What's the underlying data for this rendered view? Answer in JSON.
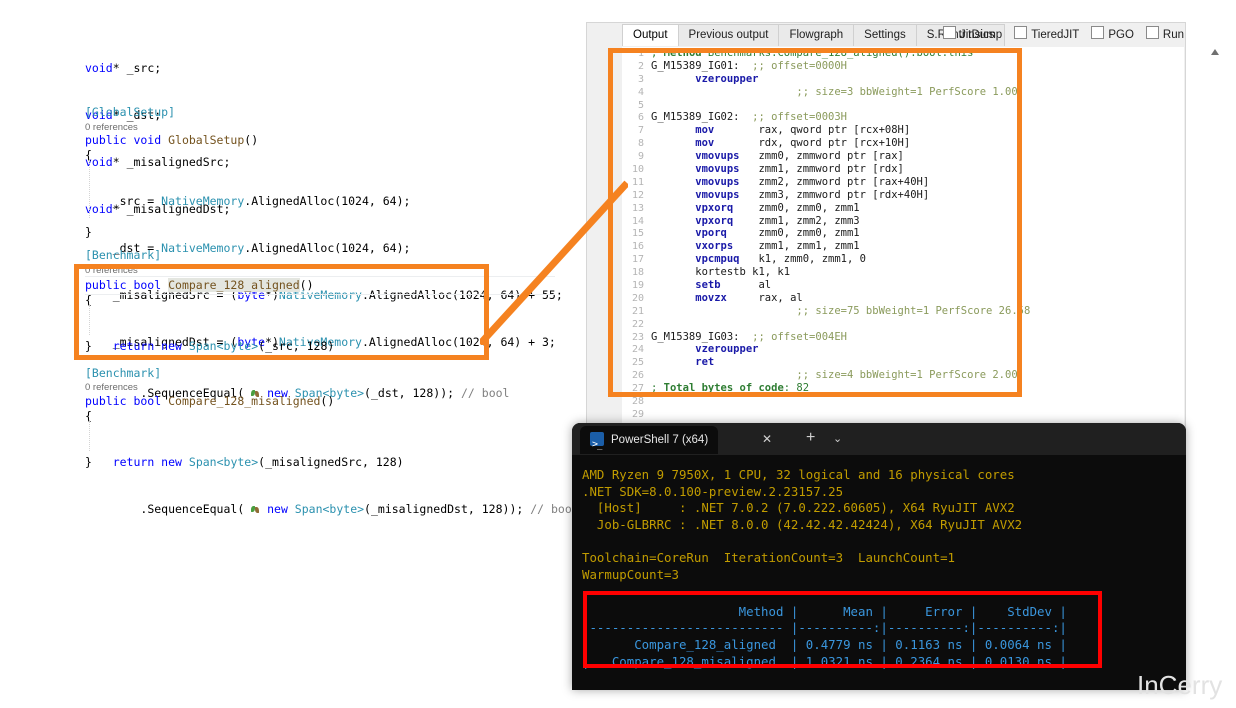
{
  "editor": {
    "fields": [
      "void* _src;",
      "void* _dst;",
      "void* _misalignedSrc;",
      "void* _misalignedDst;"
    ],
    "global_setup": {
      "attribute": "[GlobalSetup]",
      "codelens": "0 references",
      "signature_prefix": "public void ",
      "signature_name": "GlobalSetup",
      "signature_suffix": "()",
      "open_brace": "{",
      "body": [
        "_src = NativeMemory.AlignedAlloc(1024, 64);",
        "_dst = NativeMemory.AlignedAlloc(1024, 64);",
        "_misalignedSrc = (byte*)NativeMemory.AlignedAlloc(1024, 64) + 55;",
        "_misalignedDst = (byte*)NativeMemory.AlignedAlloc(1024, 64) + 3;"
      ],
      "close_brace": "}"
    },
    "benchmark_aligned": {
      "attribute": "[Benchmark]",
      "codelens": "0 references",
      "signature_prefix": "public bool ",
      "signature_name": "Compare_128_aligned",
      "signature_suffix": "()",
      "open_brace": "{",
      "line1_return": "return new ",
      "line1_type": "Span",
      "line1_generic": "<byte>",
      "line1_args": "(_src, 128)",
      "line2_method": ".SequenceEqual( ",
      "line2_new": "new ",
      "line2_type": "Span",
      "line2_generic": "<byte>",
      "line2_args": "(_dst, 128));",
      "line2_comment": "// bool",
      "close_brace": "}"
    },
    "benchmark_misaligned": {
      "attribute": "[Benchmark]",
      "codelens": "0 references",
      "signature_prefix": "public bool ",
      "signature_name": "Compare_128_misaligned",
      "signature_suffix": "()",
      "open_brace": "{",
      "line1_return": "return new ",
      "line1_type": "Span",
      "line1_generic": "<byte>",
      "line1_args": "(_misalignedSrc, 128)",
      "line2_method": ".SequenceEqual( ",
      "line2_new": "new ",
      "line2_type": "Span",
      "line2_generic": "<byte>",
      "line2_args": "(_misalignedDst, 128));",
      "line2_comment": "// bool",
      "close_brace": "}"
    }
  },
  "disasm_panel": {
    "tabs": [
      {
        "label": "Output",
        "active": true
      },
      {
        "label": "Previous output",
        "active": false
      },
      {
        "label": "Flowgraph",
        "active": false
      },
      {
        "label": "Settings",
        "active": false
      },
      {
        "label": "S.R.Intrinsics",
        "active": false
      }
    ],
    "checkboxes": [
      {
        "label": "JitDump",
        "checked": false
      },
      {
        "label": "TieredJIT",
        "checked": false
      },
      {
        "label": "PGO",
        "checked": false
      },
      {
        "label": "Run",
        "checked": false
      }
    ],
    "asm_lines": [
      {
        "n": "1",
        "segs": [
          {
            "t": "; ",
            "c": "a-green"
          },
          {
            "t": "Method",
            "c": "a-cmt"
          },
          {
            "t": " Benchmarks:Compare_128_aligned():bool:this",
            "c": "a-green"
          }
        ]
      },
      {
        "n": "2",
        "segs": [
          {
            "t": "G_M15389_IG01:",
            "c": "a-lbl"
          },
          {
            "t": "  ;; offset=0000H",
            "c": "a-cmt2"
          }
        ]
      },
      {
        "n": "3",
        "segs": [
          {
            "t": "       vzeroupper",
            "c": "a-ins"
          }
        ]
      },
      {
        "n": "4",
        "segs": [
          {
            "t": "                       ;; size=3 bbWeight=1 PerfScore 1.00",
            "c": "a-cmt2"
          }
        ]
      },
      {
        "n": "5",
        "segs": []
      },
      {
        "n": "6",
        "segs": [
          {
            "t": "G_M15389_IG02:",
            "c": "a-lbl"
          },
          {
            "t": "  ;; offset=0003H",
            "c": "a-cmt2"
          }
        ]
      },
      {
        "n": "7",
        "segs": [
          {
            "t": "       mov",
            "c": "a-ins"
          },
          {
            "t": "       rax, qword ptr [rcx+08H]",
            "c": "a-op"
          }
        ]
      },
      {
        "n": "8",
        "segs": [
          {
            "t": "       mov",
            "c": "a-ins"
          },
          {
            "t": "       rdx, qword ptr [rcx+10H]",
            "c": "a-op"
          }
        ]
      },
      {
        "n": "9",
        "segs": [
          {
            "t": "       vmovups",
            "c": "a-ins"
          },
          {
            "t": "   zmm0, zmmword ptr [rax]",
            "c": "a-op"
          }
        ]
      },
      {
        "n": "10",
        "segs": [
          {
            "t": "       vmovups",
            "c": "a-ins"
          },
          {
            "t": "   zmm1, zmmword ptr [rdx]",
            "c": "a-op"
          }
        ]
      },
      {
        "n": "11",
        "segs": [
          {
            "t": "       vmovups",
            "c": "a-ins"
          },
          {
            "t": "   zmm2, zmmword ptr [rax+40H]",
            "c": "a-op"
          }
        ]
      },
      {
        "n": "12",
        "segs": [
          {
            "t": "       vmovups",
            "c": "a-ins"
          },
          {
            "t": "   zmm3, zmmword ptr [rdx+40H]",
            "c": "a-op"
          }
        ]
      },
      {
        "n": "13",
        "segs": [
          {
            "t": "       vpxorq",
            "c": "a-ins"
          },
          {
            "t": "    zmm0, zmm0, zmm1",
            "c": "a-op"
          }
        ]
      },
      {
        "n": "14",
        "segs": [
          {
            "t": "       vpxorq",
            "c": "a-ins"
          },
          {
            "t": "    zmm1, zmm2, zmm3",
            "c": "a-op"
          }
        ]
      },
      {
        "n": "15",
        "segs": [
          {
            "t": "       vporq",
            "c": "a-ins"
          },
          {
            "t": "     zmm0, zmm0, zmm1",
            "c": "a-op"
          }
        ]
      },
      {
        "n": "16",
        "segs": [
          {
            "t": "       vxorps",
            "c": "a-ins"
          },
          {
            "t": "    zmm1, zmm1, zmm1",
            "c": "a-op"
          }
        ]
      },
      {
        "n": "17",
        "segs": [
          {
            "t": "       vpcmpuq",
            "c": "a-ins"
          },
          {
            "t": "   k1, zmm0, zmm1, 0",
            "c": "a-op"
          }
        ]
      },
      {
        "n": "18",
        "segs": [
          {
            "t": "       kortestb k1, k1",
            "c": "a-op"
          }
        ]
      },
      {
        "n": "19",
        "segs": [
          {
            "t": "       setb",
            "c": "a-ins"
          },
          {
            "t": "      al",
            "c": "a-op"
          }
        ]
      },
      {
        "n": "20",
        "segs": [
          {
            "t": "       movzx",
            "c": "a-ins"
          },
          {
            "t": "     rax, al",
            "c": "a-op"
          }
        ]
      },
      {
        "n": "21",
        "segs": [
          {
            "t": "                       ;; size=75 bbWeight=1 PerfScore 26.58",
            "c": "a-cmt2"
          }
        ]
      },
      {
        "n": "22",
        "segs": []
      },
      {
        "n": "23",
        "segs": [
          {
            "t": "G_M15389_IG03:",
            "c": "a-lbl"
          },
          {
            "t": "  ;; offset=004EH",
            "c": "a-cmt2"
          }
        ]
      },
      {
        "n": "24",
        "segs": [
          {
            "t": "       vzeroupper",
            "c": "a-ins"
          }
        ]
      },
      {
        "n": "25",
        "segs": [
          {
            "t": "       ret",
            "c": "a-ins"
          }
        ]
      },
      {
        "n": "26",
        "segs": [
          {
            "t": "                       ;; size=4 bbWeight=1 PerfScore 2.00",
            "c": "a-cmt2"
          }
        ]
      },
      {
        "n": "27",
        "segs": [
          {
            "t": "; ",
            "c": "a-green"
          },
          {
            "t": "Total bytes of code",
            "c": "a-cmt"
          },
          {
            "t": ": 82",
            "c": "a-green"
          }
        ]
      },
      {
        "n": "28",
        "segs": []
      },
      {
        "n": "29",
        "segs": []
      }
    ]
  },
  "terminal": {
    "tab_title": "PowerShell 7 (x64)",
    "close_label": "✕",
    "new_tab_label": "+",
    "menu_label": "⌄",
    "output_lines": [
      "AMD Ryzen 9 7950X, 1 CPU, 32 logical and 16 physical cores",
      ".NET SDK=8.0.100-preview.2.23157.25",
      "  [Host]     : .NET 7.0.2 (7.0.222.60605), X64 RyuJIT AVX2",
      "  Job-GLBRRC : .NET 8.0.0 (42.42.42.42424), X64 RyuJIT AVX2",
      "",
      "Toolchain=CoreRun  IterationCount=3  LaunchCount=1",
      "WarmupCount=3",
      ""
    ],
    "results_lines": [
      "|                    Method |      Mean |     Error |    StdDev |",
      "|-------------------------- |----------:|----------:|----------:|",
      "|      Compare_128_aligned  | 0.4779 ns | 0.1163 ns | 0.0064 ns |",
      "|   Compare_128_misaligned  | 1.0321 ns | 0.2364 ns | 0.0130 ns |"
    ]
  },
  "benchmark_results": {
    "columns": [
      "Method",
      "Mean",
      "Error",
      "StdDev"
    ],
    "rows": [
      {
        "method": "Compare_128_aligned",
        "mean": "0.4779 ns",
        "error": "0.1163 ns",
        "stddev": "0.0064 ns"
      },
      {
        "method": "Compare_128_misaligned",
        "mean": "1.0321 ns",
        "error": "0.2364 ns",
        "stddev": "0.0130 ns"
      }
    ]
  },
  "watermark": {
    "text": "InCerry"
  },
  "colors": {
    "callout_orange": "#f58220",
    "results_red": "#ff0000",
    "terminal_bg": "#0c0c0c",
    "terminal_yellow": "#c19c00",
    "terminal_cyan": "#3a96dd"
  }
}
